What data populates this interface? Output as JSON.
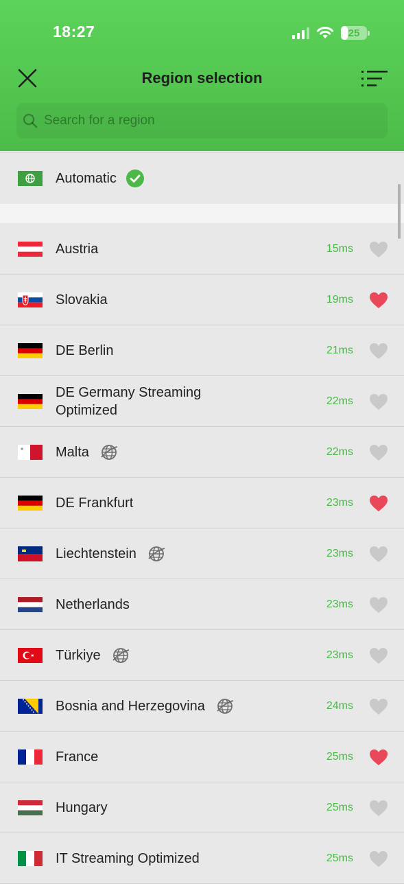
{
  "status": {
    "time": "18:27",
    "battery": "25"
  },
  "header": {
    "title": "Region selection",
    "search_placeholder": "Search for a region"
  },
  "automatic": {
    "label": "Automatic"
  },
  "regions": [
    {
      "name": "Austria",
      "ping": "15ms",
      "favorite": false,
      "globe": false,
      "flag": "austria"
    },
    {
      "name": "Slovakia",
      "ping": "19ms",
      "favorite": true,
      "globe": false,
      "flag": "slovakia"
    },
    {
      "name": "DE Berlin",
      "ping": "21ms",
      "favorite": false,
      "globe": false,
      "flag": "germany"
    },
    {
      "name": "DE Germany Streaming Optimized",
      "ping": "22ms",
      "favorite": false,
      "globe": false,
      "flag": "germany"
    },
    {
      "name": "Malta",
      "ping": "22ms",
      "favorite": false,
      "globe": true,
      "flag": "malta"
    },
    {
      "name": "DE Frankfurt",
      "ping": "23ms",
      "favorite": true,
      "globe": false,
      "flag": "germany"
    },
    {
      "name": "Liechtenstein",
      "ping": "23ms",
      "favorite": false,
      "globe": true,
      "flag": "liechtenstein"
    },
    {
      "name": "Netherlands",
      "ping": "23ms",
      "favorite": false,
      "globe": false,
      "flag": "netherlands"
    },
    {
      "name": "Türkiye",
      "ping": "23ms",
      "favorite": false,
      "globe": true,
      "flag": "turkey"
    },
    {
      "name": "Bosnia and Herzegovina",
      "ping": "24ms",
      "favorite": false,
      "globe": true,
      "flag": "bosnia"
    },
    {
      "name": "France",
      "ping": "25ms",
      "favorite": true,
      "globe": false,
      "flag": "france"
    },
    {
      "name": "Hungary",
      "ping": "25ms",
      "favorite": false,
      "globe": false,
      "flag": "hungary"
    },
    {
      "name": "IT Streaming Optimized",
      "ping": "25ms",
      "favorite": false,
      "globe": false,
      "flag": "italy"
    }
  ],
  "colors": {
    "accent": "#4cbc48",
    "ping": "#4bb84a",
    "favorite": "#e8485a",
    "heart_inactive": "#c9c9c9"
  }
}
